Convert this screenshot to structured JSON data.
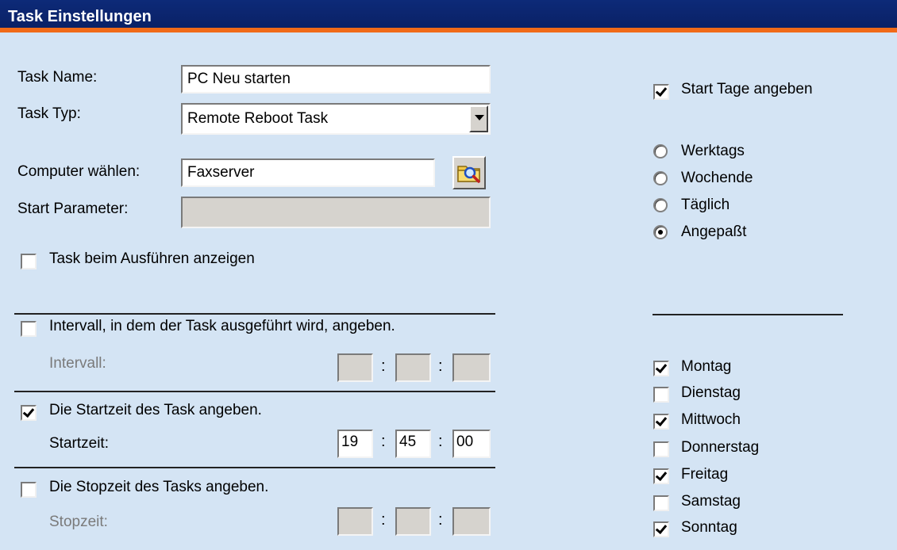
{
  "window": {
    "title": "Task Einstellungen"
  },
  "task": {
    "name_label": "Task Name:",
    "name_value": "PC Neu starten",
    "type_label": "Task Typ:",
    "type_value": "Remote Reboot Task",
    "computer_label": "Computer wählen:",
    "computer_value": "Faxserver",
    "params_label": "Start Parameter:",
    "params_value": "",
    "show_on_run": {
      "label": "Task beim Ausführen anzeigen",
      "checked": false
    }
  },
  "interval": {
    "checkbox": {
      "label": "Intervall, in dem der Task ausgeführt wird, angeben.",
      "checked": false
    },
    "label": "Intervall:",
    "hh": "",
    "mm": "",
    "ss": ""
  },
  "start_time": {
    "checkbox": {
      "label": "Die Startzeit des Task angeben.",
      "checked": true
    },
    "label": "Startzeit:",
    "hh": "19",
    "mm": "45",
    "ss": "00"
  },
  "stop_time": {
    "checkbox": {
      "label": "Die Stopzeit des Tasks angeben.",
      "checked": false
    },
    "label": "Stopzeit:",
    "hh": "",
    "mm": "",
    "ss": ""
  },
  "time_separator": ":",
  "days": {
    "specify": {
      "label": "Start Tage angeben",
      "checked": true
    },
    "mode_options": [
      {
        "label": "Werktags",
        "selected": false
      },
      {
        "label": "Wochende",
        "selected": false
      },
      {
        "label": "Täglich",
        "selected": false
      },
      {
        "label": "Angepaßt",
        "selected": true
      }
    ],
    "weekdays": [
      {
        "label": "Montag",
        "checked": true
      },
      {
        "label": "Dienstag",
        "checked": false
      },
      {
        "label": "Mittwoch",
        "checked": true
      },
      {
        "label": "Donnerstag",
        "checked": false
      },
      {
        "label": "Freitag",
        "checked": true
      },
      {
        "label": "Samstag",
        "checked": false
      },
      {
        "label": "Sonntag",
        "checked": true
      }
    ]
  },
  "colors": {
    "title_bar": "#0a2166",
    "accent": "#f06a18",
    "panel": "#d4e4f4"
  },
  "icons": {
    "browse": "folder-search-icon",
    "dropdown": "chevron-down-icon"
  }
}
